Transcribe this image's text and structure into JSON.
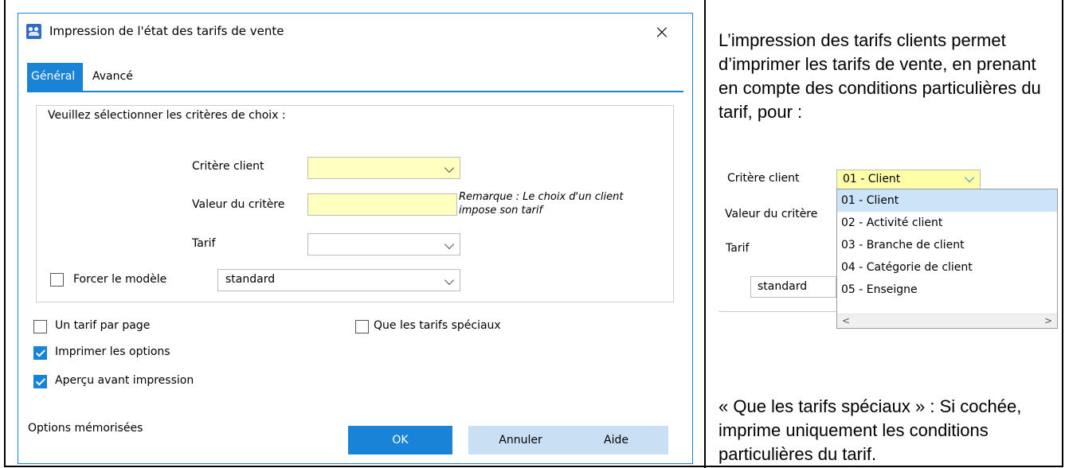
{
  "dialog": {
    "title": "Impression de l'état des tarifs de vente",
    "close_glyph": "×",
    "tabs": [
      {
        "label": "Général",
        "active": true
      },
      {
        "label": "Avancé",
        "active": false
      }
    ],
    "group_title": "Veuillez sélectionner les critères de choix :",
    "fields": {
      "critere_client": {
        "label": "Critère client",
        "value": ""
      },
      "valeur_critere": {
        "label": "Valeur du critère",
        "value": ""
      },
      "tarif": {
        "label": "Tarif",
        "value": ""
      },
      "forcer_modele": {
        "label": "Forcer le modèle",
        "checked": false,
        "value": "standard"
      }
    },
    "remark": [
      "Remarque : Le choix d'un client",
      "impose son tarif"
    ],
    "checkboxes": {
      "un_tarif_par_page": {
        "label": "Un tarif par page",
        "checked": false
      },
      "que_tarifs_speciaux": {
        "label": "Que les tarifs spéciaux",
        "checked": false
      },
      "imprimer_options": {
        "label": "Imprimer les options",
        "checked": true
      },
      "apercu": {
        "label": "Aperçu avant impression",
        "checked": true
      }
    },
    "footer_label": "Options mémorisées",
    "buttons": {
      "ok": "OK",
      "cancel": "Annuler",
      "help": "Aide"
    },
    "accent_color": "#1883d7",
    "field_highlight_color": "#ffffc0"
  },
  "side_panel": {
    "description": "L’impression des tarifs clients permet d’imprimer les tarifs de vente, en prenant en compte des conditions particulières du tarif, pour :",
    "mini_dialog": {
      "critere_label": "Critère client",
      "critere_value": "01 - Client",
      "valeur_label": "Valeur du critère",
      "tarif_label": "Tarif",
      "model_value": "standard",
      "options": [
        "01 - Client",
        "02 - Activité client",
        "03 - Branche de client",
        "04 - Catégorie de client",
        "05 - Enseigne"
      ],
      "selected_index": 0,
      "scroll_left": "<",
      "scroll_right": ">"
    },
    "note": "« Que les tarifs spéciaux » : Si cochée, imprime uniquement les conditions particulières du tarif."
  }
}
